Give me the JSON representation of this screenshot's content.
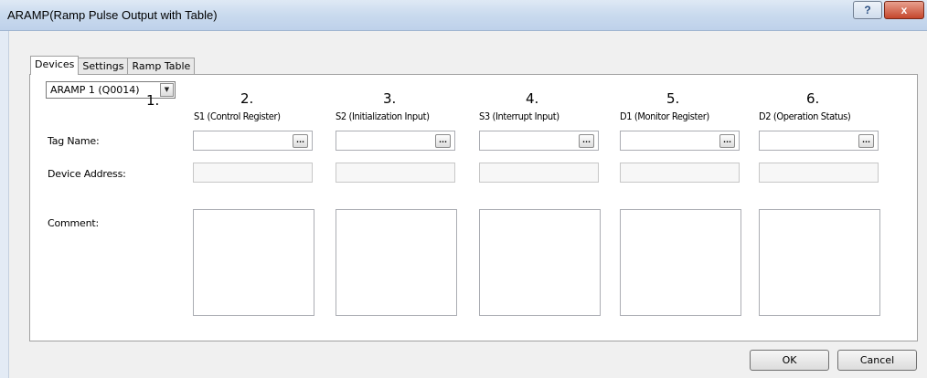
{
  "window": {
    "title": "ARAMP(Ramp Pulse Output with Table)",
    "help_label": "?",
    "close_label": "x"
  },
  "tabs": [
    {
      "label": "Devices"
    },
    {
      "label": "Settings"
    },
    {
      "label": "Ramp Table"
    }
  ],
  "selector": {
    "value": "ARAMP 1 (Q0014)",
    "marker": "1."
  },
  "columns": [
    {
      "number": "2.",
      "header": "S1 (Control Register)"
    },
    {
      "number": "3.",
      "header": "S2 (Initialization Input)"
    },
    {
      "number": "4.",
      "header": "S3 (Interrupt Input)"
    },
    {
      "number": "5.",
      "header": "D1 (Monitor Register)"
    },
    {
      "number": "6.",
      "header": "D2 (Operation Status)"
    }
  ],
  "rows": {
    "tag_name": "Tag Name:",
    "device_address": "Device Address:",
    "comment": "Comment:"
  },
  "browse_label": "...",
  "buttons": {
    "ok": "OK",
    "cancel": "Cancel"
  }
}
